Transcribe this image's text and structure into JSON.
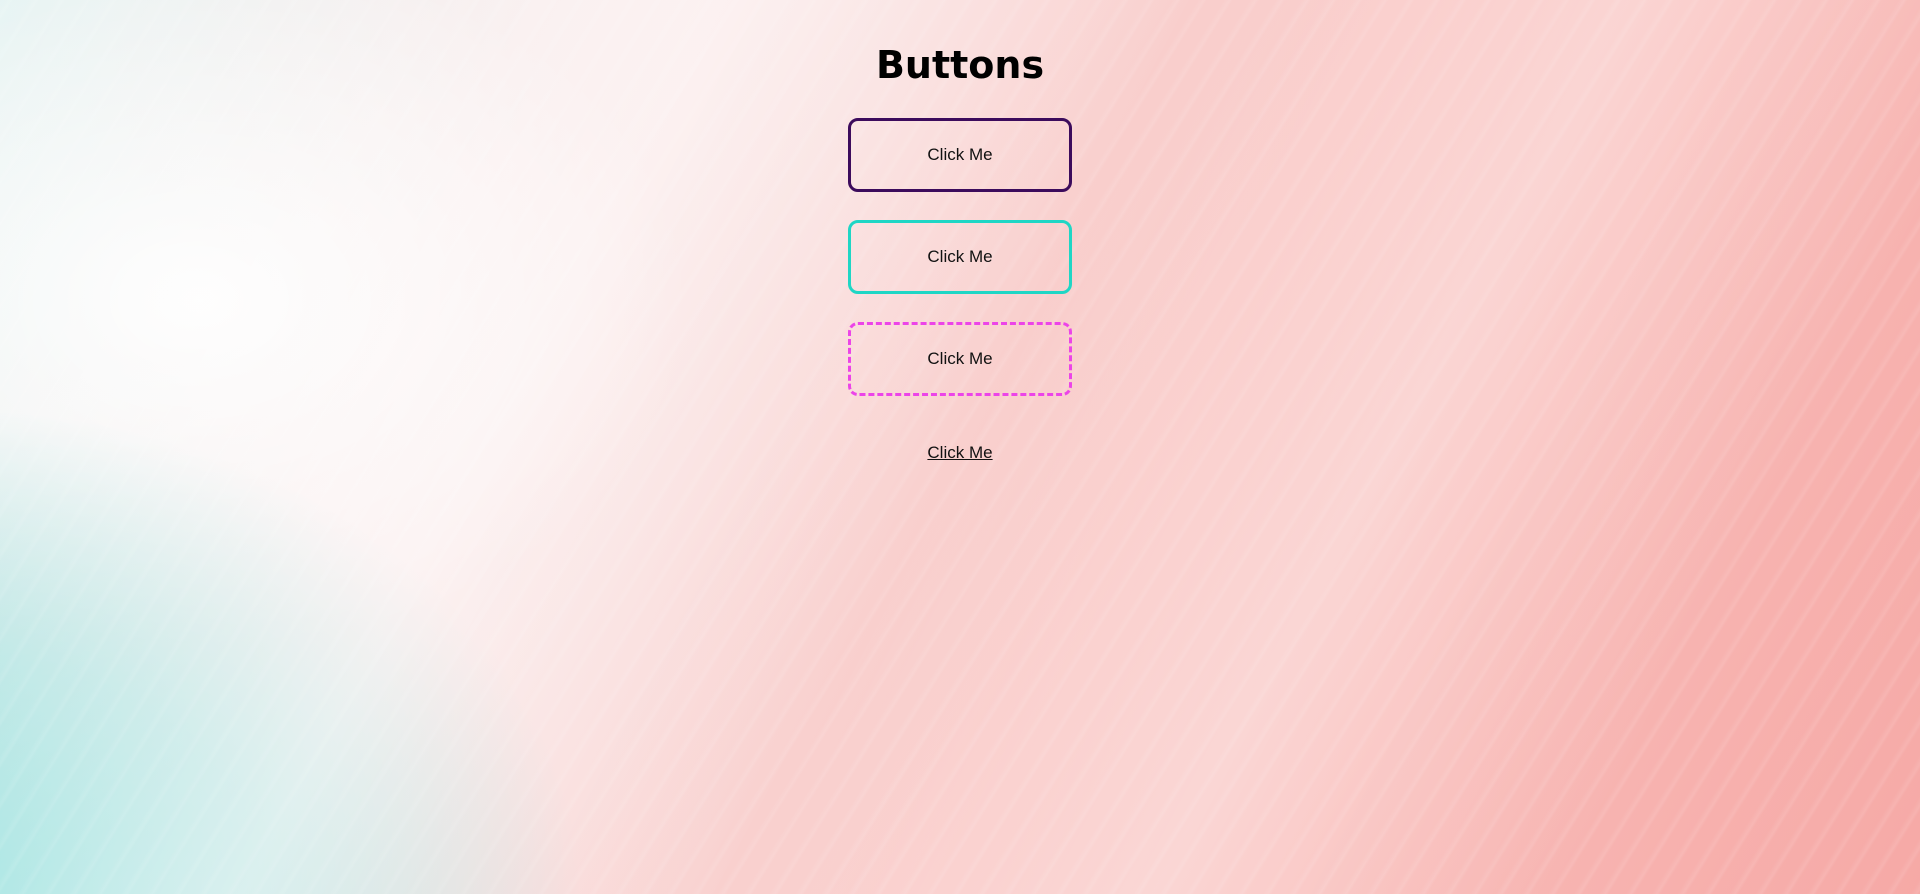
{
  "page": {
    "title": "Buttons"
  },
  "buttons": [
    {
      "label": "Click Me",
      "style": "solid",
      "border_color": "#3c0b5c"
    },
    {
      "label": "Click Me",
      "style": "solid",
      "border_color": "#1fd6c5"
    },
    {
      "label": "Click Me",
      "style": "dashed",
      "border_color": "#ec44e8"
    },
    {
      "label": "Click Me",
      "style": "link"
    }
  ]
}
